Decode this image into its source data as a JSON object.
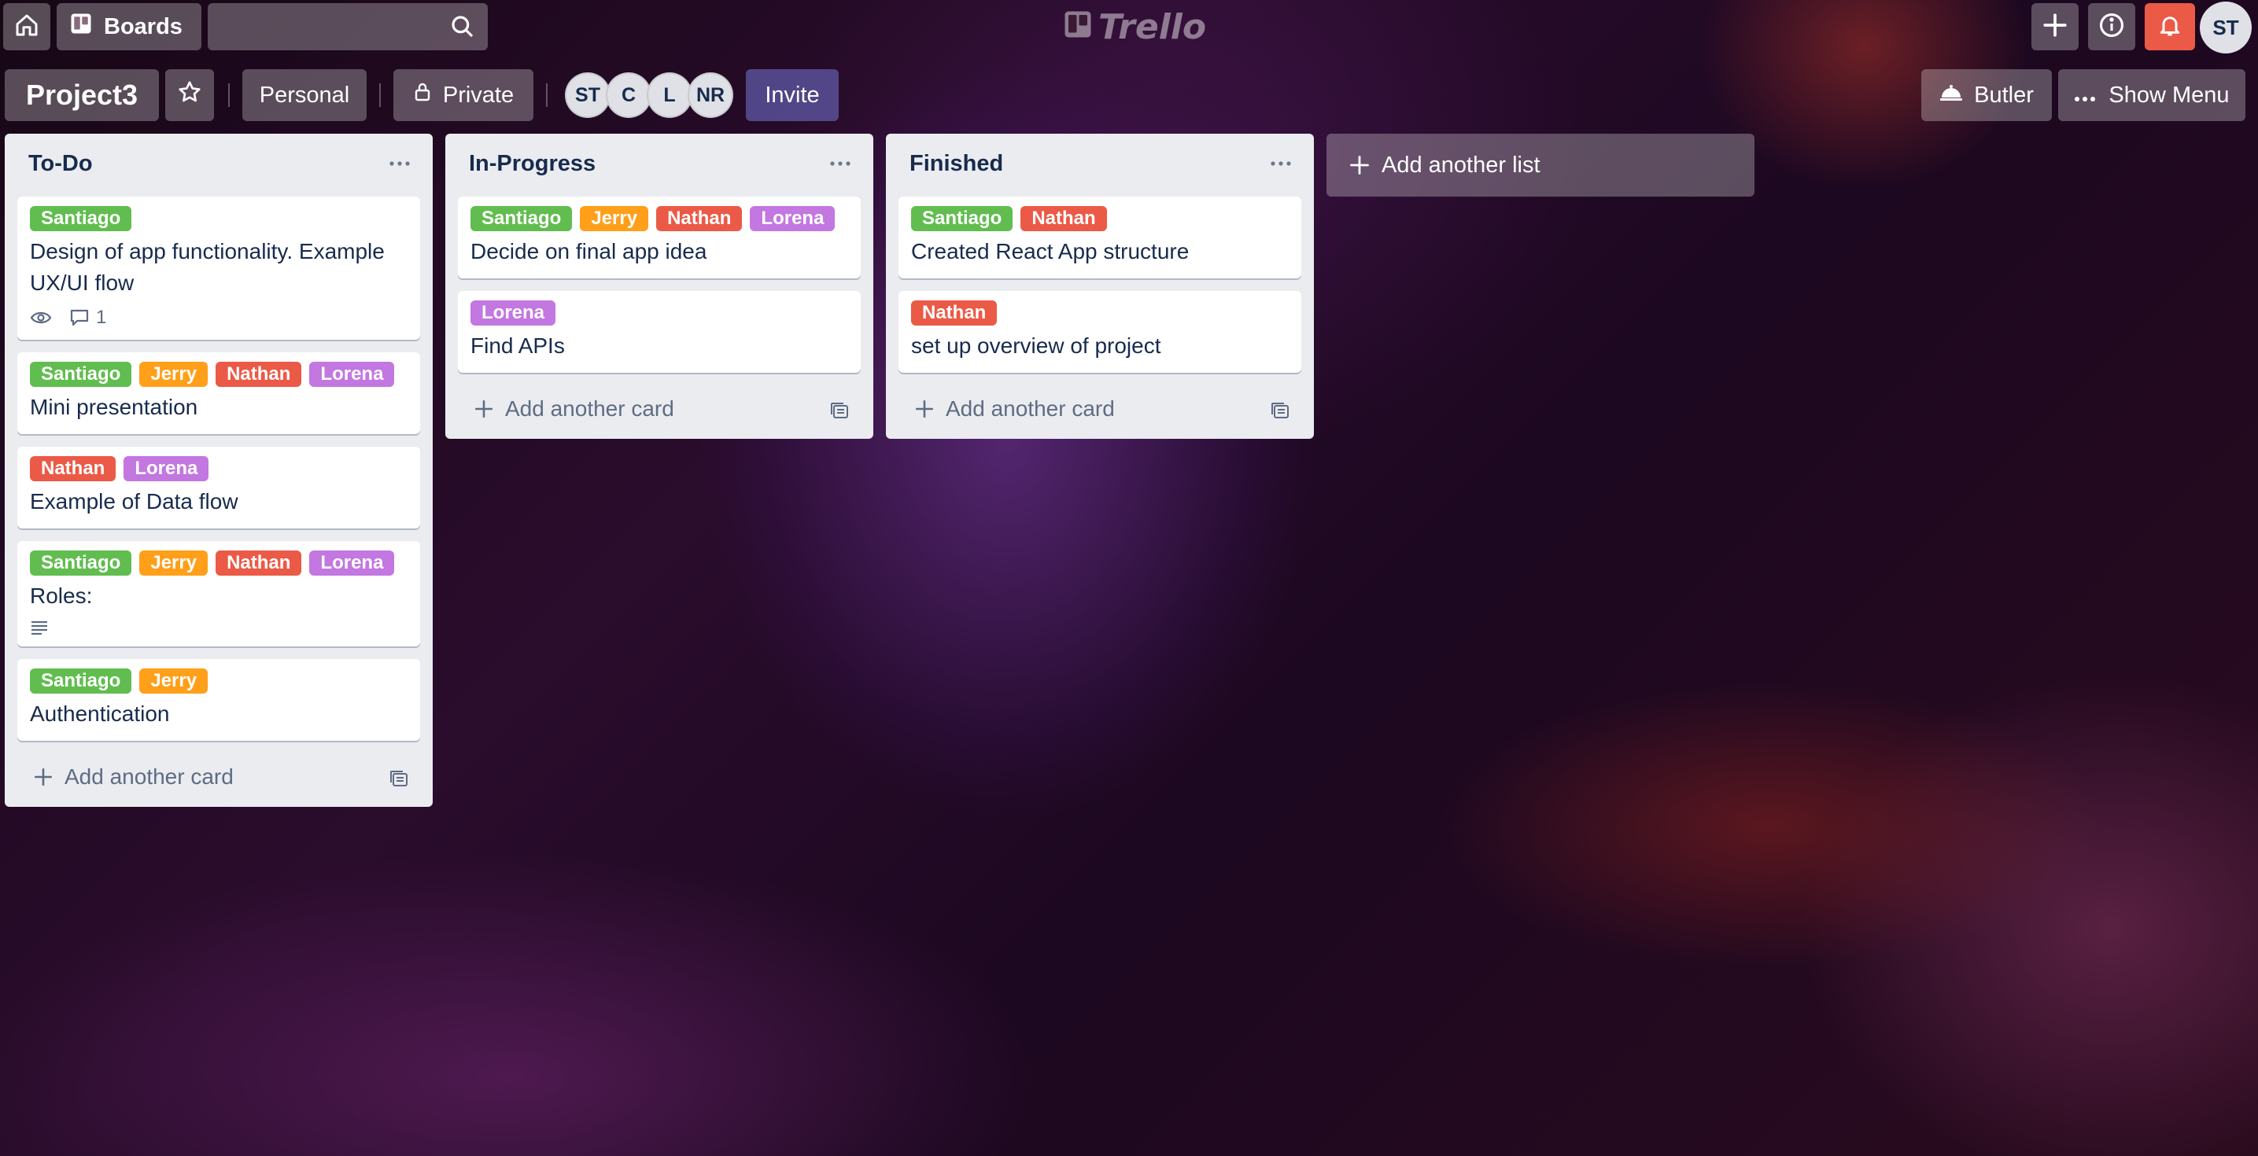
{
  "colors": {
    "green": "#61bd4f",
    "orange": "#ff9f1a",
    "red": "#eb5a46",
    "purple": "#c377e0",
    "list_bg": "#ebecf0",
    "text": "#172b4d"
  },
  "topbar": {
    "home_icon": "home-icon",
    "boards_label": "Boards",
    "search_placeholder": "",
    "logo_text": "Trello",
    "user_initials": "ST"
  },
  "board": {
    "title": "Project3",
    "visibility_team": "Personal",
    "visibility": "Private",
    "invite_label": "Invite",
    "butler_label": "Butler",
    "menu_label": "Show Menu",
    "members": [
      "ST",
      "C",
      "L",
      "NR"
    ]
  },
  "lists": [
    {
      "title": "To-Do",
      "add_card_label": "Add another card",
      "cards": [
        {
          "labels": [
            {
              "text": "Santiago",
              "color": "green"
            }
          ],
          "title": "Design of app functionality. Example UX/UI flow",
          "watching": true,
          "comments": "1"
        },
        {
          "labels": [
            {
              "text": "Santiago",
              "color": "green"
            },
            {
              "text": "Jerry",
              "color": "orange"
            },
            {
              "text": "Nathan",
              "color": "red"
            },
            {
              "text": "Lorena",
              "color": "purple"
            }
          ],
          "title": "Mini presentation"
        },
        {
          "labels": [
            {
              "text": "Nathan",
              "color": "red"
            },
            {
              "text": "Lorena",
              "color": "purple"
            }
          ],
          "title": "Example of Data flow"
        },
        {
          "labels": [
            {
              "text": "Santiago",
              "color": "green"
            },
            {
              "text": "Jerry",
              "color": "orange"
            },
            {
              "text": "Nathan",
              "color": "red"
            },
            {
              "text": "Lorena",
              "color": "purple"
            }
          ],
          "title": "Roles:",
          "description": true
        },
        {
          "labels": [
            {
              "text": "Santiago",
              "color": "green"
            },
            {
              "text": "Jerry",
              "color": "orange"
            }
          ],
          "title": "Authentication"
        }
      ]
    },
    {
      "title": "In-Progress",
      "add_card_label": "Add another card",
      "cards": [
        {
          "labels": [
            {
              "text": "Santiago",
              "color": "green"
            },
            {
              "text": "Jerry",
              "color": "orange"
            },
            {
              "text": "Nathan",
              "color": "red"
            },
            {
              "text": "Lorena",
              "color": "purple"
            }
          ],
          "title": "Decide on final app idea"
        },
        {
          "labels": [
            {
              "text": "Lorena",
              "color": "purple"
            }
          ],
          "title": "Find APIs"
        }
      ]
    },
    {
      "title": "Finished",
      "add_card_label": "Add another card",
      "cards": [
        {
          "labels": [
            {
              "text": "Santiago",
              "color": "green"
            },
            {
              "text": "Nathan",
              "color": "red"
            }
          ],
          "title": "Created React App structure"
        },
        {
          "labels": [
            {
              "text": "Nathan",
              "color": "red"
            }
          ],
          "title": "set up overview of project"
        }
      ]
    }
  ],
  "add_list_label": "Add another list"
}
